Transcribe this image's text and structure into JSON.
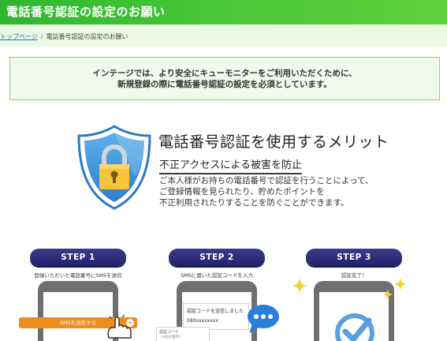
{
  "header": {
    "title": "電話番号認証の設定のお願い"
  },
  "breadcrumb": {
    "home": "トップページ",
    "separator": "/",
    "current": "電話番号認証の設定のお願い"
  },
  "notice": {
    "line1": "インテージでは、より安全にキューモニターをご利用いただくために、",
    "line2": "新規登録の際に電話番号認証の設定を必須としています。"
  },
  "merit": {
    "title": "電話番号認証を使用するメリット",
    "subtitle": "不正アクセスによる被害を防止",
    "body": [
      "ご本人様がお持ちの電話番号で認証を行うことによって、",
      "ご登録情報を見られたり、貯めたポイントを",
      "不正利用されたりすることを防ぐことができます。"
    ]
  },
  "steps": [
    {
      "label": "STEP 1",
      "description": "登録いただいた電話番号にSMSを送信"
    },
    {
      "label": "STEP 2",
      "description": "SMSに届いた認証コードを入力"
    },
    {
      "label": "STEP 3",
      "description": "認証完了！"
    }
  ],
  "step1_phone": {
    "button_label": "SMSを送信する",
    "plus": "+"
  },
  "step2_phone": {
    "sent_text": "認証コードを送信しました",
    "phone_number": "080xxxxxxxx",
    "form_label": "認証コード",
    "form_hint": "（4桁の数字）"
  },
  "icons": {
    "shield": "shield-lock-icon",
    "hand": "pointing-hand-icon",
    "bubble": "speech-bubble-icon",
    "check": "check-circle-icon",
    "sparkle": "sparkle-icon"
  },
  "colors": {
    "header_green": "#3dbd34",
    "notice_bg": "#f0f9ec",
    "notice_border": "#8fce76",
    "step_pill": "#2a2b75",
    "sms_button": "#f08c1e",
    "shield_blue": "#3a8fd6",
    "check_blue": "#5aa0e0",
    "sparkle_yellow": "#f5d020"
  }
}
